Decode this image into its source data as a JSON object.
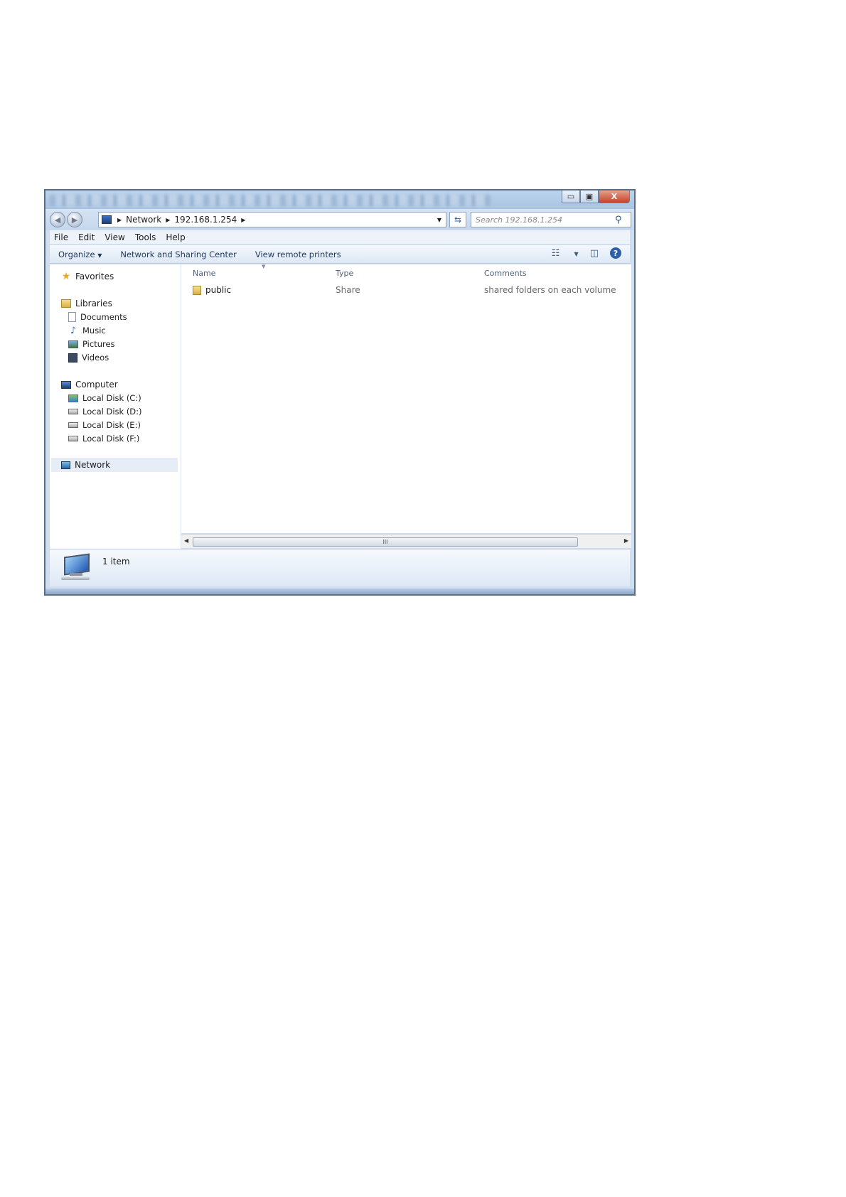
{
  "window": {
    "caption_buttons": {
      "minimize": "▭",
      "maximize": "▣",
      "close": "X"
    }
  },
  "navigation": {
    "back_icon": "back-arrow-icon",
    "forward_icon": "forward-arrow-icon",
    "breadcrumb": [
      "Network",
      "192.168.1.254"
    ],
    "search_placeholder": "Search 192.168.1.254"
  },
  "menu": [
    "File",
    "Edit",
    "View",
    "Tools",
    "Help"
  ],
  "commands": {
    "organize": "Organize",
    "network_sharing": "Network and Sharing Center",
    "view_printers": "View remote printers"
  },
  "sidebar": {
    "favorites": "Favorites",
    "libraries": "Libraries",
    "library_items": [
      "Documents",
      "Music",
      "Pictures",
      "Videos"
    ],
    "computer": "Computer",
    "drives": [
      "Local Disk (C:)",
      "Local Disk (D:)",
      "Local Disk (E:)",
      "Local Disk (F:)"
    ],
    "network": "Network"
  },
  "columns": {
    "name": "Name",
    "type": "Type",
    "comments": "Comments"
  },
  "files": [
    {
      "name": "public",
      "type": "Share",
      "comments": "shared folders on each volume"
    }
  ],
  "scrollbar_grip": "III",
  "status": {
    "item_count": "1 item"
  },
  "colors": {
    "frame": "#5a6f8a",
    "accent": "#2e5fa8",
    "close": "#c3432a"
  }
}
